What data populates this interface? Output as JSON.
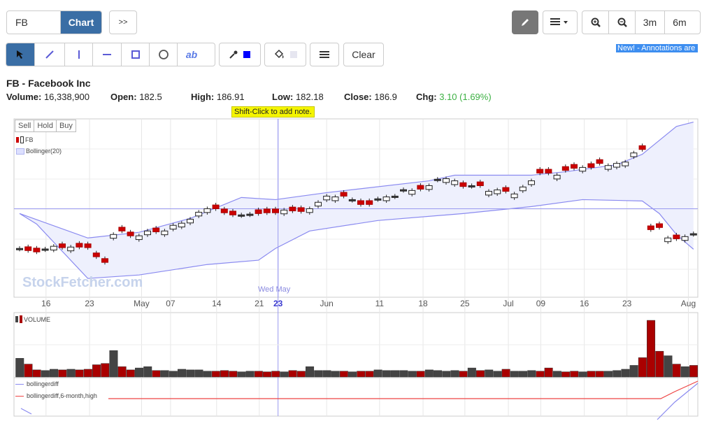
{
  "toolbar": {
    "symbol_value": "FB",
    "chart_label": "Chart",
    "more_label": ">>",
    "clear_label": "Clear",
    "text_tool_label": "ab",
    "range_3m": "3m",
    "range_6m": "6m",
    "news_text": "New! - Annotations are",
    "draw_color": "#0000ff",
    "fill_color": "#e6e6f0"
  },
  "quote": {
    "title": "FB - Facebook Inc",
    "volume_label": "Volume:",
    "volume": "16,338,900",
    "open_label": "Open:",
    "open": "182.5",
    "high_label": "High:",
    "high": "186.91",
    "low_label": "Low:",
    "low": "182.18",
    "close_label": "Close:",
    "close": "186.9",
    "chg_label": "Chg:",
    "chg": "3.10 (1.69%)",
    "chg_color": "#3cb043"
  },
  "chart": {
    "tooltip": "Shift-Click to add note.",
    "sell": "Sell",
    "hold": "Hold",
    "buy": "Buy",
    "legend_fb": "FB",
    "legend_bb": "Bollinger(20)",
    "watermark": "StockFetcher.com",
    "crosshair_label": "Wed May",
    "volume_label": "VOLUME",
    "ind1": "bollingerdiff",
    "ind2": "bollingerdiff,6-month,high"
  },
  "chart_data": {
    "type": "candlestick",
    "ylim": [
      147,
      213.5
    ],
    "crosshair": {
      "index": 30.3,
      "price": 180
    },
    "close": [
      164.9,
      164.4,
      163.9,
      164.7,
      166.0,
      165.5,
      165.7,
      165.7,
      165.5,
      162.1,
      160.0,
      170.4,
      171.7,
      169.9,
      169.9,
      171.7,
      171.4,
      171.7,
      173.8,
      174.6,
      176.1,
      178.7,
      180.0,
      180.0,
      178.5,
      177.7,
      177.4,
      177.7,
      178.2,
      178.5,
      178.5,
      179.5,
      179.2,
      179.0,
      180.0,
      182.4,
      184.7,
      184.4,
      184.7,
      183.1,
      181.6,
      181.6,
      183.4,
      184.4,
      184.4,
      186.8,
      186.8,
      187.3,
      188.6,
      190.7,
      191.2,
      190.4,
      188.3,
      188.3,
      188.6,
      186.5,
      187.0,
      186.5,
      185.5,
      188.1,
      190.4,
      193.3,
      193.3,
      192.5,
      194.3,
      195.1,
      195.4,
      195.4,
      196.9,
      196.1,
      196.9,
      197.4,
      200.8,
      202.1,
      172.2,
      173.0,
      169.1,
      168.8,
      169.6,
      170.4
    ],
    "direction": "drrdwrwrrrrwrrwwrwwwwwwrrrddrrrwrrwwwwrdrrdwddwrwdwwrdrwwrwwwrrwrrwrrwwwwrrrwrw",
    "volume_millions": [
      11.6,
      8,
      4.4,
      4,
      4.8,
      4.4,
      4.8,
      4.4,
      4.8,
      7.6,
      8.4,
      16.4,
      6.4,
      4.4,
      5.6,
      6.4,
      4,
      4,
      3.6,
      4.8,
      4.4,
      4.4,
      3.6,
      3.6,
      4,
      3.6,
      3.2,
      3.6,
      3.6,
      3.2,
      3.6,
      3.2,
      4,
      3.6,
      6.4,
      4,
      4,
      3.6,
      3.6,
      3.2,
      3.6,
      3.6,
      4.4,
      4,
      4,
      4,
      3.6,
      3.6,
      4.4,
      4,
      3.6,
      4,
      3.6,
      5.6,
      4,
      4.4,
      3.6,
      4.8,
      3.6,
      3.6,
      4,
      3.6,
      5.6,
      3.6,
      3.2,
      3.6,
      3.2,
      3.6,
      3.6,
      3.6,
      4,
      4.8,
      7.2,
      12,
      35.2,
      16,
      13.2,
      8,
      6.4,
      7.2
    ],
    "bollinger_upper": [
      [
        0,
        178.2
      ],
      [
        8,
        169.1
      ],
      [
        14,
        171.2
      ],
      [
        20,
        176.4
      ],
      [
        26,
        184.2
      ],
      [
        30,
        183.4
      ],
      [
        36,
        186.0
      ],
      [
        48,
        190.4
      ],
      [
        51,
        192.5
      ],
      [
        60,
        192.5
      ],
      [
        64,
        193.8
      ],
      [
        70,
        196.4
      ],
      [
        73,
        200.3
      ],
      [
        75,
        205.5
      ],
      [
        77,
        210.7
      ],
      [
        79,
        212.3
      ]
    ],
    "bollinger_lower": [
      [
        0,
        178.2
      ],
      [
        2,
        174.3
      ],
      [
        8,
        154.0
      ],
      [
        14,
        155.3
      ],
      [
        22,
        159.2
      ],
      [
        28,
        160.8
      ],
      [
        30,
        165.2
      ],
      [
        34,
        171.7
      ],
      [
        42,
        175.6
      ],
      [
        52,
        178.2
      ],
      [
        60,
        180.8
      ],
      [
        66,
        183.4
      ],
      [
        73,
        182.9
      ],
      [
        75,
        178.2
      ],
      [
        77,
        170.4
      ],
      [
        79,
        164.9
      ]
    ],
    "x_ticks": [
      {
        "i": 3.1,
        "label": "16"
      },
      {
        "i": 8.2,
        "label": "23"
      },
      {
        "i": 14.3,
        "label": "May"
      },
      {
        "i": 17.7,
        "label": "07"
      },
      {
        "i": 23.1,
        "label": "14"
      },
      {
        "i": 28.1,
        "label": "21"
      },
      {
        "i": 30.3,
        "label": "23",
        "highlight": true
      },
      {
        "i": 36,
        "label": "Jun"
      },
      {
        "i": 42.2,
        "label": "11"
      },
      {
        "i": 47.3,
        "label": "18"
      },
      {
        "i": 52.2,
        "label": "25"
      },
      {
        "i": 57.3,
        "label": "Jul"
      },
      {
        "i": 61.1,
        "label": "09"
      },
      {
        "i": 66.2,
        "label": "16"
      },
      {
        "i": 71.2,
        "label": "23"
      },
      {
        "i": 78.4,
        "label": "Aug"
      }
    ]
  }
}
